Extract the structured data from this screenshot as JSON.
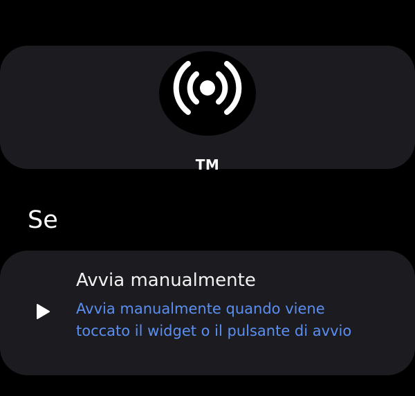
{
  "header": {
    "icon": "broadcast-icon",
    "title": "TM"
  },
  "section": {
    "title": "Se"
  },
  "option": {
    "icon": "play-icon",
    "title": "Avvia manualmente",
    "description": "Avvia manualmente quando viene toccato il widget o il pulsante di avvio"
  },
  "colors": {
    "background": "#000000",
    "card": "#1c1b20",
    "accent": "#5b8ff0",
    "text": "#ffffff"
  }
}
